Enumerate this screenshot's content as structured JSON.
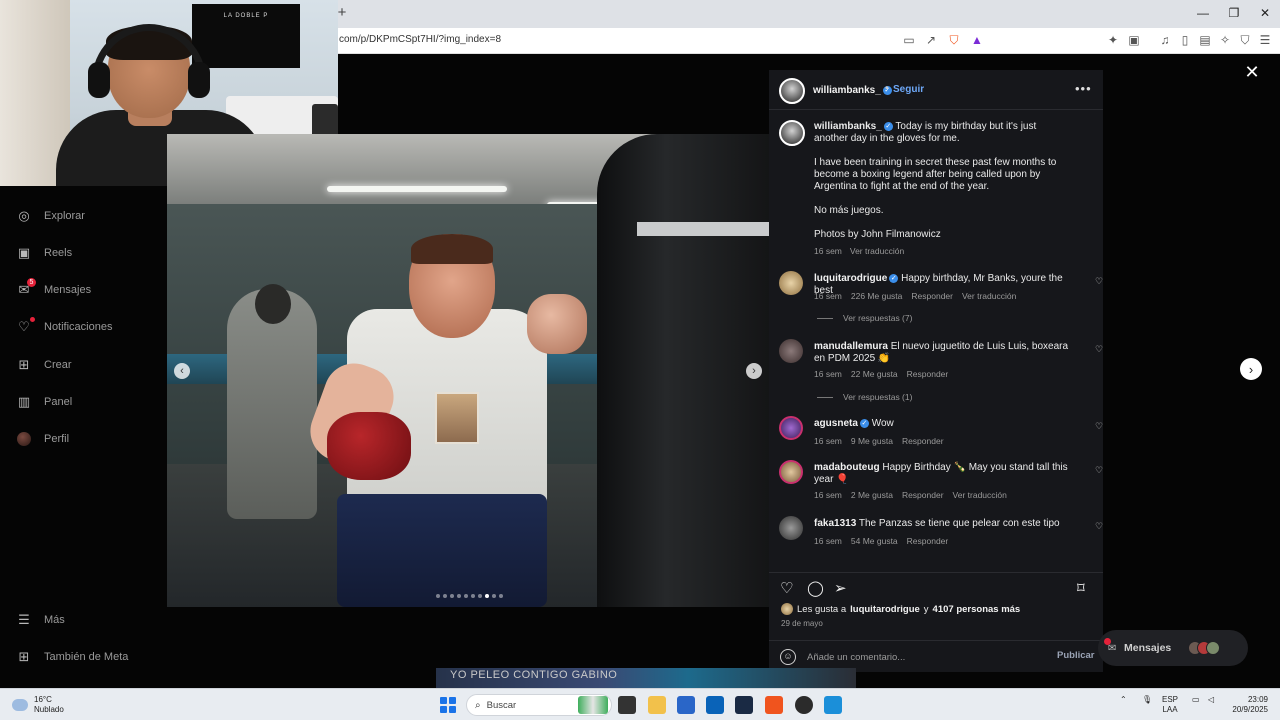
{
  "browser": {
    "new_tab": "+",
    "url": "com/p/DKPmCSpt7HI/?img_index=8",
    "window_controls": [
      "—",
      "❐",
      "✕"
    ]
  },
  "nav": {
    "items": [
      {
        "label": "Explorar",
        "icon": "compass-icon"
      },
      {
        "label": "Reels",
        "icon": "reels-icon"
      },
      {
        "label": "Mensajes",
        "icon": "messenger-icon",
        "badge": "5"
      },
      {
        "label": "Notificaciones",
        "icon": "heart-icon"
      },
      {
        "label": "Crear",
        "icon": "plus-square-icon"
      },
      {
        "label": "Panel",
        "icon": "chart-icon"
      },
      {
        "label": "Perfil",
        "icon": "avatar"
      }
    ],
    "more": "Más",
    "meta": "También de Meta"
  },
  "webcam": {
    "poster_text": "LA DOBLE P"
  },
  "post": {
    "username": "williambanks_",
    "follow": "Seguir",
    "caption": {
      "line1": "Today is my birthday but it's just another day in the gloves for me.",
      "line2": "I have been training in secret these past few months to become a boxing legend after being called upon by Argentina to fight at the end of the year.",
      "line3": "No más juegos.",
      "line4": "Photos by John Filmanowicz",
      "time": "16 sem",
      "translate": "Ver traducción"
    },
    "comments": [
      {
        "user": "luquitarodrigue",
        "verified": true,
        "text": "Happy birthday, Mr Banks, youre the best",
        "time": "16 sem",
        "likes": "226 Me gusta",
        "reply": "Responder",
        "translate": "Ver traducción",
        "replies": "Ver respuestas (7)"
      },
      {
        "user": "manudallemura",
        "verified": false,
        "text": "El nuevo juguetito de Luis Luis, boxeara en PDM 2025 👏",
        "time": "16 sem",
        "likes": "22 Me gusta",
        "reply": "Responder",
        "replies": "Ver respuestas (1)"
      },
      {
        "user": "agusneta",
        "verified": true,
        "text": "Wow",
        "time": "16 sem",
        "likes": "9 Me gusta",
        "reply": "Responder"
      },
      {
        "user": "madabouteug",
        "verified": false,
        "text": "Happy Birthday 🍾 May you stand tall this year 🎈",
        "time": "16 sem",
        "likes": "2 Me gusta",
        "reply": "Responder",
        "translate": "Ver traducción"
      },
      {
        "user": "faka1313",
        "verified": false,
        "text": "The Panzas se tiene que pelear con este tipo",
        "time": "16 sem",
        "likes": "54 Me gusta",
        "reply": "Responder"
      }
    ],
    "likes_prefix": "Les gusta a",
    "likes_user": "luquitarodrigue",
    "likes_join": "y",
    "likes_others": "4107 personas más",
    "date": "29 de mayo",
    "comment_placeholder": "Añade un comentario...",
    "publish": "Publicar",
    "carousel_index": 8,
    "carousel_total": 10
  },
  "messages_pill": {
    "label": "Mensajes"
  },
  "stream": {
    "banner": "YO PELEO CONTIGO GABINO"
  },
  "taskbar": {
    "temp": "16°C",
    "weather": "Nublado",
    "search": "Buscar",
    "lang1": "ESP",
    "lang2": "LAA",
    "time": "23:09",
    "date": "20/9/2025"
  }
}
